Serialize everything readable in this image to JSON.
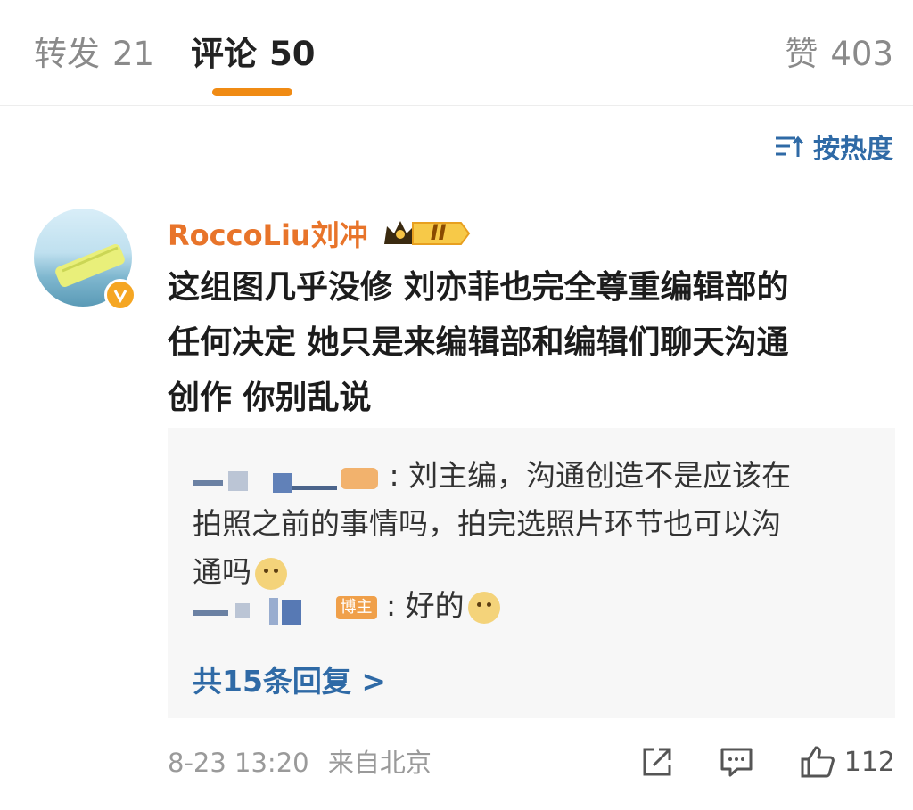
{
  "tabs": {
    "repost_label": "转发",
    "repost_count": "21",
    "comment_label": "评论",
    "comment_count": "50",
    "like_label": "赞",
    "like_count": "403"
  },
  "sort": {
    "label": "按热度",
    "icon": "sort-icon"
  },
  "comment": {
    "author": "RoccoLiu刘冲",
    "badge": "II",
    "text_lines": [
      "这组图几乎没修 刘亦菲也完全尊重编辑部的",
      "任何决定 她只是来编辑部和编辑们聊天沟通",
      "创作 你别乱说"
    ],
    "time": "8-23 13:20",
    "source": "来自北京",
    "like_count": "112"
  },
  "replies": [
    {
      "separator": ":",
      "text_lines": [
        "刘主编，沟通创造不是应该在",
        "拍照之前的事情吗，拍完选照片环节也可以沟",
        "通吗"
      ],
      "emoji": "doge-emoji"
    },
    {
      "tag": "博主",
      "separator": ":",
      "text": "好的",
      "emoji": "doge-emoji"
    }
  ],
  "more_replies": "共15条回复 >",
  "colors": {
    "accent": "#f08b14",
    "link": "#2f6aa6",
    "author": "#e8742a"
  }
}
